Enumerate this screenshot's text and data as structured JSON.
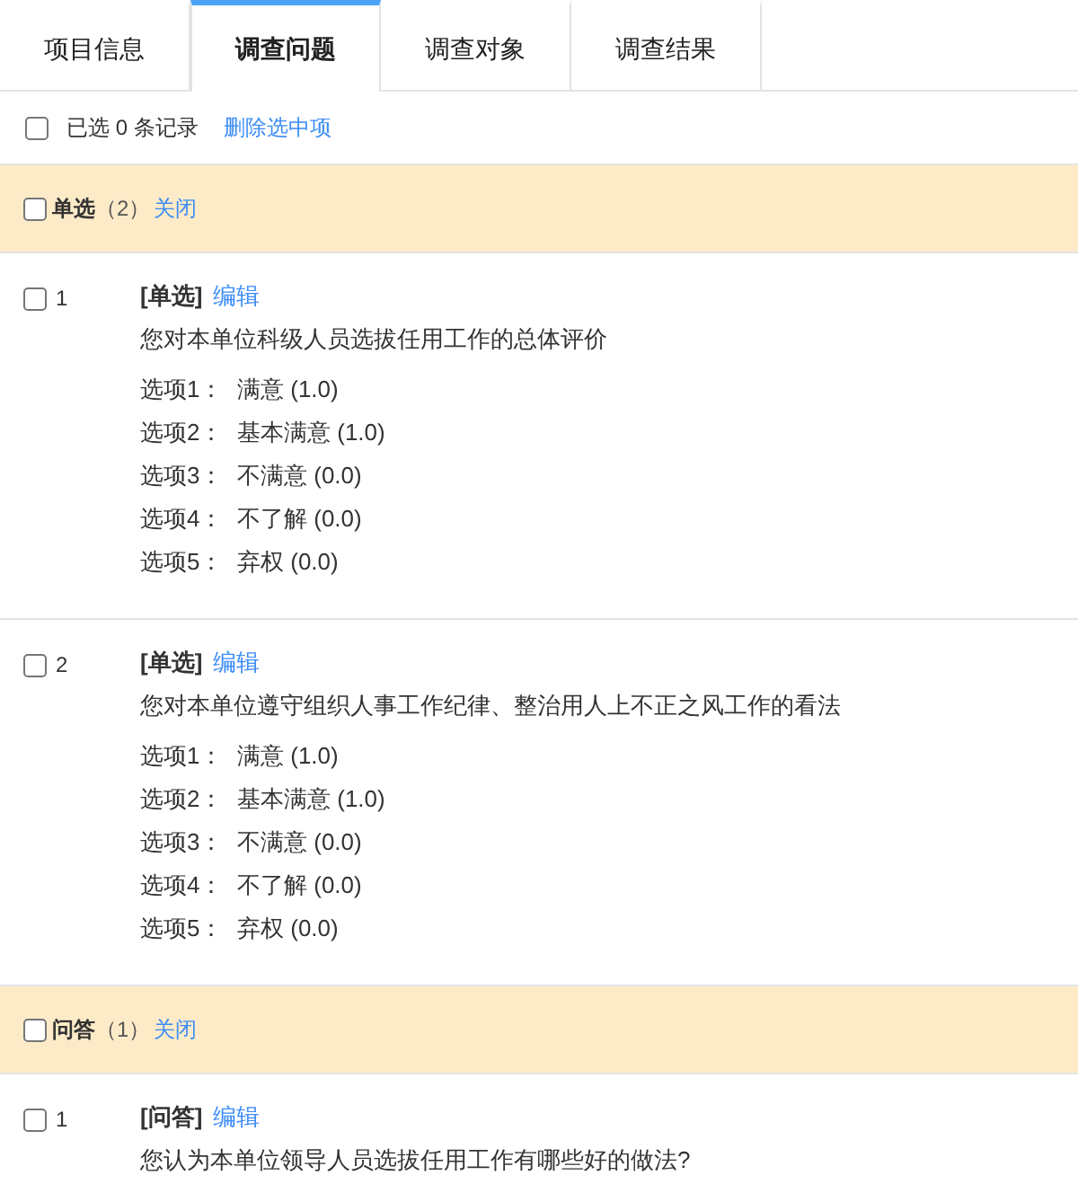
{
  "tabs": [
    {
      "label": "项目信息",
      "selected": false
    },
    {
      "label": "调查问题",
      "selected": true
    },
    {
      "label": "调查对象",
      "selected": false
    },
    {
      "label": "调查结果",
      "selected": false
    }
  ],
  "toolbar": {
    "checked": false,
    "summary": "已选 0 条记录",
    "action": "删除选中项"
  },
  "groups": [
    {
      "type": "单选",
      "count": "（2）",
      "action": "关闭",
      "checked": false,
      "questions": [
        {
          "number": "1",
          "checked": false,
          "tag": "[单选]",
          "edit": "编辑",
          "text": "您对本单位科级人员选拔任用工作的总体评价",
          "options": [
            {
              "label": "选项1：",
              "value": "满意 (1.0)"
            },
            {
              "label": "选项2：",
              "value": "基本满意 (1.0)"
            },
            {
              "label": "选项3：",
              "value": "不满意 (0.0)"
            },
            {
              "label": "选项4：",
              "value": "不了解 (0.0)"
            },
            {
              "label": "选项5：",
              "value": "弃权 (0.0)"
            }
          ]
        },
        {
          "number": "2",
          "checked": false,
          "tag": "[单选]",
          "edit": "编辑",
          "text": "您对本单位遵守组织人事工作纪律、整治用人上不正之风工作的看法",
          "options": [
            {
              "label": "选项1：",
              "value": "满意 (1.0)"
            },
            {
              "label": "选项2：",
              "value": "基本满意 (1.0)"
            },
            {
              "label": "选项3：",
              "value": "不满意 (0.0)"
            },
            {
              "label": "选项4：",
              "value": "不了解 (0.0)"
            },
            {
              "label": "选项5：",
              "value": "弃权 (0.0)"
            }
          ]
        }
      ]
    },
    {
      "type": "问答",
      "count": "（1）",
      "action": "关闭",
      "checked": false,
      "questions": [
        {
          "number": "1",
          "checked": false,
          "tag": "[问答]",
          "edit": "编辑",
          "text": "您认为本单位领导人员选拔任用工作有哪些好的做法?"
        }
      ]
    }
  ]
}
